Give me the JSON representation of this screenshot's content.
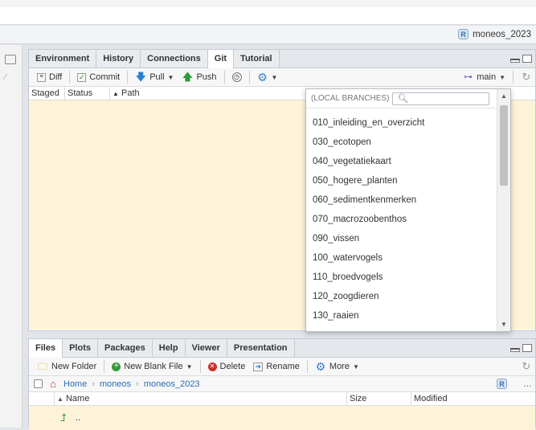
{
  "project": {
    "name": "moneos_2023",
    "logo_text": "R"
  },
  "top_pane": {
    "tabs": [
      "Environment",
      "History",
      "Connections",
      "Git",
      "Tutorial"
    ],
    "active_tab": "Git",
    "toolbar": {
      "diff": "Diff",
      "commit": "Commit",
      "pull": "Pull",
      "push": "Push",
      "branch": "main"
    },
    "columns": [
      "Staged",
      "Status",
      "Path"
    ]
  },
  "branch_dropdown": {
    "header": "(LOCAL BRANCHES)",
    "search_placeholder": "",
    "branches": [
      "010_inleiding_en_overzicht",
      "030_ecotopen",
      "040_vegetatiekaart",
      "050_hogere_planten",
      "060_sedimentkenmerken",
      "070_macrozoobenthos",
      "090_vissen",
      "100_watervogels",
      "110_broedvogels",
      "120_zoogdieren",
      "130_raaien"
    ]
  },
  "bottom_pane": {
    "tabs": [
      "Files",
      "Plots",
      "Packages",
      "Help",
      "Viewer",
      "Presentation"
    ],
    "active_tab": "Files",
    "toolbar": {
      "new_folder": "New Folder",
      "new_blank_file": "New Blank File",
      "delete": "Delete",
      "rename": "Rename",
      "more": "More"
    },
    "breadcrumb": [
      "Home",
      "moneos",
      "moneos_2023"
    ],
    "columns": [
      "Name",
      "Size",
      "Modified"
    ],
    "rows": [
      {
        "name": ".."
      }
    ]
  },
  "colors": {
    "git_body": "#fdf3d8",
    "link": "#2a6db5"
  }
}
